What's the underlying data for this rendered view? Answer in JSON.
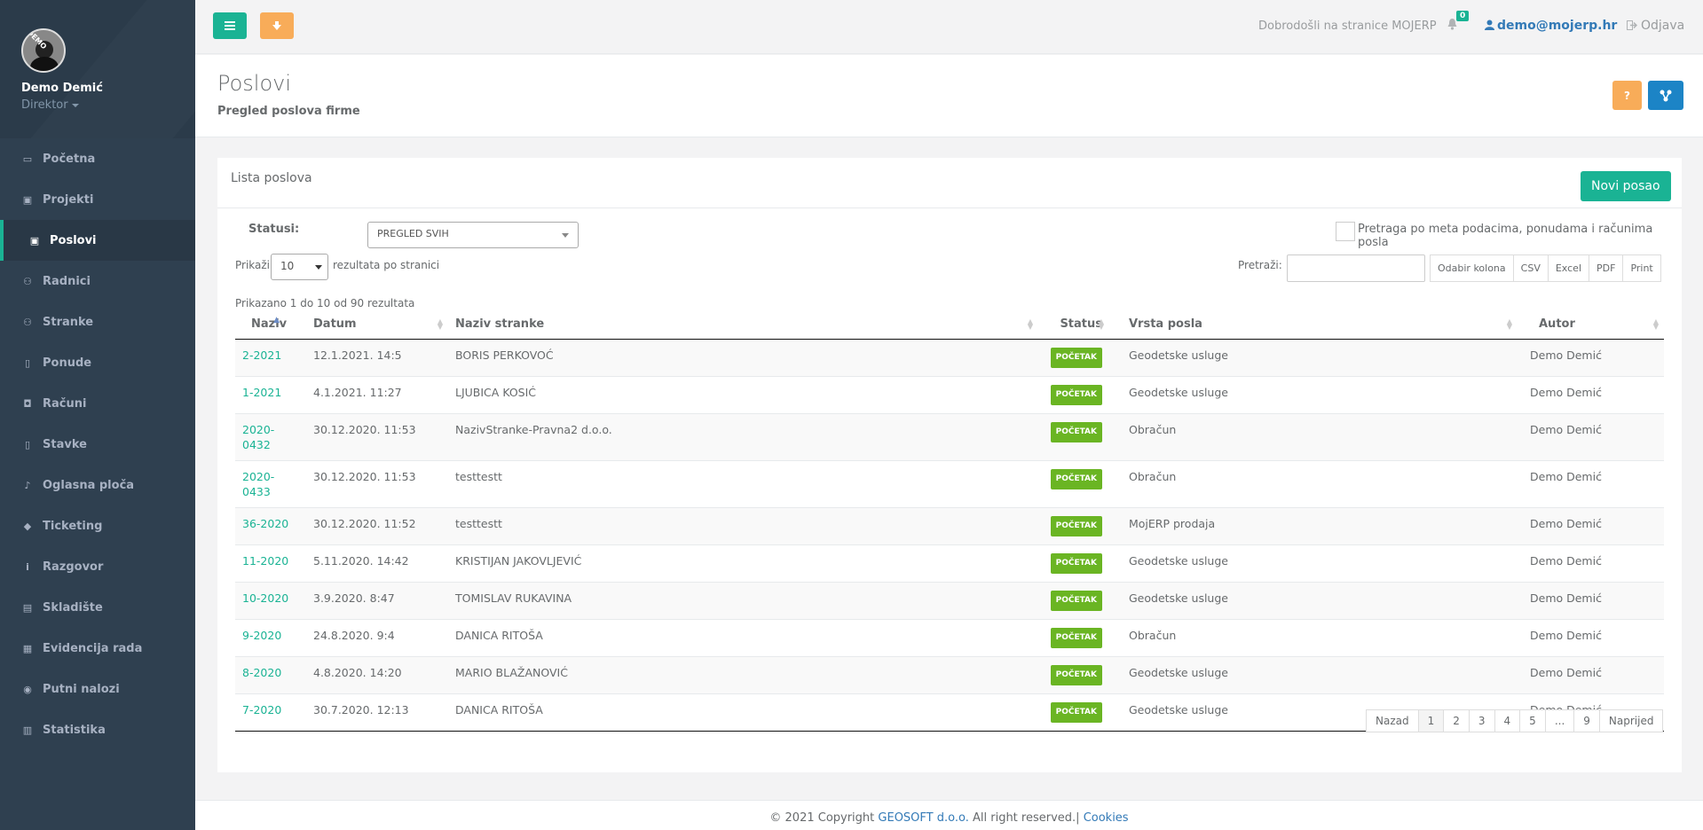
{
  "profile": {
    "name": "Demo Demić",
    "role": "Direktor",
    "avatar_tag": "DEMO"
  },
  "nav": [
    {
      "label": "Početna",
      "icon": "laptop-icon",
      "glyph": "▭",
      "active": false
    },
    {
      "label": "Projekti",
      "icon": "briefcase-icon",
      "glyph": "▣",
      "active": false
    },
    {
      "label": "Poslovi",
      "icon": "briefcase-icon",
      "glyph": "▣",
      "active": true
    },
    {
      "label": "Radnici",
      "icon": "users-icon",
      "glyph": "⚇",
      "active": false
    },
    {
      "label": "Stranke",
      "icon": "users-icon",
      "glyph": "⚇",
      "active": false
    },
    {
      "label": "Ponude",
      "icon": "file-icon",
      "glyph": "▯",
      "active": false
    },
    {
      "label": "Računi",
      "icon": "money-icon",
      "glyph": "◘",
      "active": false
    },
    {
      "label": "Stavke",
      "icon": "file-text-icon",
      "glyph": "▯",
      "active": false
    },
    {
      "label": "Oglasna ploča",
      "icon": "bell-icon",
      "glyph": "♪",
      "active": false
    },
    {
      "label": "Ticketing",
      "icon": "tag-icon",
      "glyph": "◆",
      "active": false
    },
    {
      "label": "Razgovor",
      "icon": "info-icon",
      "glyph": "i",
      "active": false
    },
    {
      "label": "Skladište",
      "icon": "archive-icon",
      "glyph": "▤",
      "active": false
    },
    {
      "label": "Evidencija rada",
      "icon": "calendar-icon",
      "glyph": "▦",
      "active": false
    },
    {
      "label": "Putni nalozi",
      "icon": "car-icon",
      "glyph": "◉",
      "active": false
    },
    {
      "label": "Statistika",
      "icon": "bar-chart-icon",
      "glyph": "▥",
      "active": false
    }
  ],
  "topbar": {
    "welcome": "Dobrodošli na stranice MOJERP",
    "notifications": "0",
    "user": "demo@mojerp.hr",
    "logout": "Odjava"
  },
  "heading": {
    "title": "Poslovi",
    "subtitle": "Pregled poslova firme",
    "help": "?"
  },
  "box": {
    "title": "Lista poslova",
    "new_button": "Novi posao",
    "status_label": "Statusi:",
    "status_value": "PREGLED SVIH",
    "meta_label": "Pretraga po meta podacima, ponudama i računima posla",
    "show_prefix": "Prikaži",
    "per_page": "10",
    "show_suffix": "rezultata po stranici",
    "search_label": "Pretraži:",
    "export": [
      "Odabir kolona",
      "CSV",
      "Excel",
      "PDF",
      "Print"
    ],
    "info": "Prikazano 1 do 10 od 90 rezultata"
  },
  "table": {
    "columns": [
      "Naziv",
      "Datum",
      "Naziv stranke",
      "Status",
      "Vrsta posla",
      "Autor"
    ],
    "rows": [
      [
        "2-2021",
        "12.1.2021. 14:5",
        "BORIS PERKOVOĆ",
        "POČETAK",
        "Geodetske usluge",
        "Demo Demić"
      ],
      [
        "1-2021",
        "4.1.2021. 11:27",
        "LJUBICA KOSIĆ",
        "POČETAK",
        "Geodetske usluge",
        "Demo Demić"
      ],
      [
        "2020-0432",
        "30.12.2020. 11:53",
        "NazivStranke-Pravna2 d.o.o.",
        "POČETAK",
        "Obračun",
        "Demo Demić"
      ],
      [
        "2020-0433",
        "30.12.2020. 11:53",
        "testtestt",
        "POČETAK",
        "Obračun",
        "Demo Demić"
      ],
      [
        "36-2020",
        "30.12.2020. 11:52",
        "testtestt",
        "POČETAK",
        "MojERP prodaja",
        "Demo Demić"
      ],
      [
        "11-2020",
        "5.11.2020. 14:42",
        "KRISTIJAN JAKOVLJEVIĆ",
        "POČETAK",
        "Geodetske usluge",
        "Demo Demić"
      ],
      [
        "10-2020",
        "3.9.2020. 8:47",
        "TOMISLAV RUKAVINA",
        "POČETAK",
        "Geodetske usluge",
        "Demo Demić"
      ],
      [
        "9-2020",
        "24.8.2020. 9:4",
        "DANICA RITOŠA",
        "POČETAK",
        "Obračun",
        "Demo Demić"
      ],
      [
        "8-2020",
        "4.8.2020. 14:20",
        "MARIO BLAŽANOVIĆ",
        "POČETAK",
        "Geodetske usluge",
        "Demo Demić"
      ],
      [
        "7-2020",
        "30.7.2020. 12:13",
        "DANICA RITOŠA",
        "POČETAK",
        "Geodetske usluge",
        "Demo Demić"
      ]
    ]
  },
  "pager": [
    "Nazad",
    "1",
    "2",
    "3",
    "4",
    "5",
    "...",
    "9",
    "Naprijed"
  ],
  "footer": {
    "prefix": "© 2021 Copyright",
    "company": "GEOSOFT d.o.o.",
    "suffix": "All right reserved.|",
    "cookies": "Cookies"
  },
  "colors": {
    "sidebar": "#2f4050",
    "accent": "#1ab394",
    "warning": "#f8ac59",
    "primary": "#1c84c6",
    "badge": "#6ab523"
  }
}
